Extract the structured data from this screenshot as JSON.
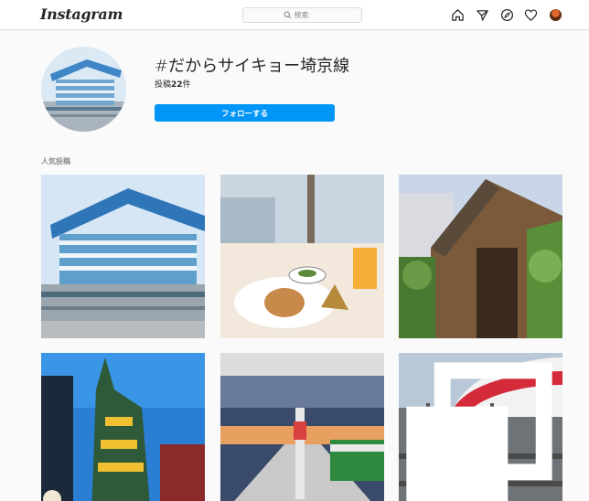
{
  "header": {
    "logo": "Instagram",
    "search_placeholder": "検索",
    "icons": [
      "home-icon",
      "direct-message-icon",
      "explore-icon",
      "activity-heart-icon",
      "profile-avatar"
    ]
  },
  "hashtag": {
    "title": "#だからサイキョー埼京線",
    "post_count_label": "投稿",
    "post_count": "22",
    "post_count_suffix": "件",
    "follow_label": "フォローする"
  },
  "top_posts": {
    "title": "人気投稿",
    "posts": [
      {
        "subject": "stadium-building",
        "multi": false
      },
      {
        "subject": "cafe-window-meal",
        "multi": false
      },
      {
        "subject": "ivy-brick-house",
        "multi": false
      },
      {
        "subject": "blue-sky-tower",
        "multi": false
      },
      {
        "subject": "station-platform",
        "multi": false
      },
      {
        "subject": "shinkansen-train",
        "multi": true
      }
    ]
  },
  "colors": {
    "accent": "#0095f6",
    "background": "#fafafa",
    "border": "#dbdbdb"
  }
}
